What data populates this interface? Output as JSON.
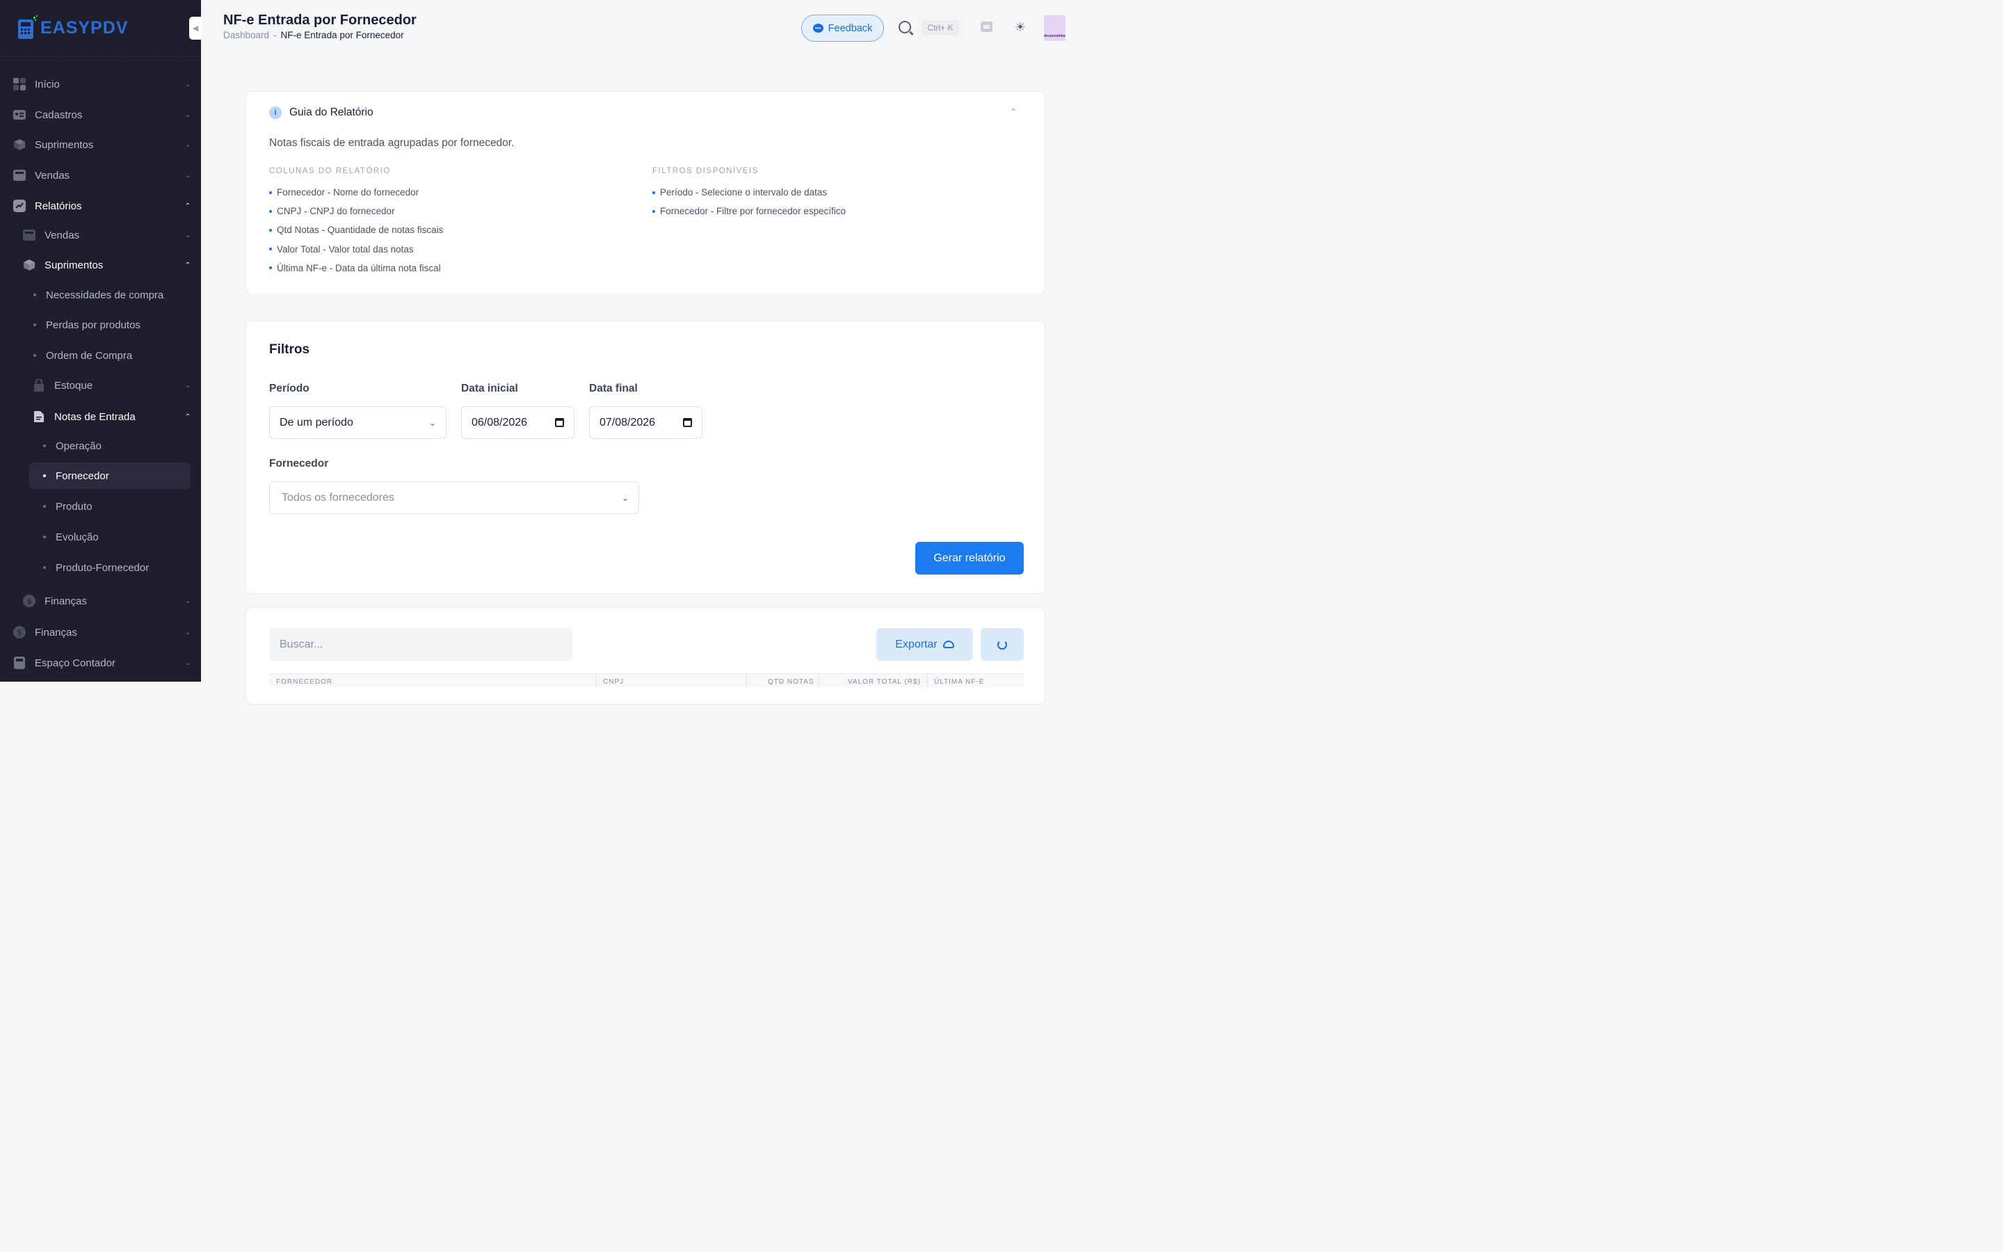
{
  "brand": {
    "name_part1": "EASY",
    "name_part2": "PDV"
  },
  "sidebar": {
    "items": [
      {
        "label": "Início"
      },
      {
        "label": "Cadastros"
      },
      {
        "label": "Suprimentos"
      },
      {
        "label": "Vendas"
      },
      {
        "label": "Relatórios"
      }
    ],
    "relatorios_children": [
      {
        "label": "Vendas"
      },
      {
        "label": "Suprimentos"
      }
    ],
    "suprimentos_children": [
      {
        "label": "Necessidades de compra"
      },
      {
        "label": "Perdas por produtos"
      },
      {
        "label": "Ordem de Compra"
      },
      {
        "label": "Estoque"
      },
      {
        "label": "Notas de Entrada"
      }
    ],
    "notas_children": [
      {
        "label": "Operação"
      },
      {
        "label": "Fornecedor"
      },
      {
        "label": "Produto"
      },
      {
        "label": "Evolução"
      },
      {
        "label": "Produto-Fornecedor"
      }
    ],
    "financas_sub": "Finanças",
    "bottom_items": [
      {
        "label": "Finanças"
      },
      {
        "label": "Espaço Contador"
      }
    ]
  },
  "header": {
    "title": "NF-e Entrada por Fornecedor",
    "breadcrumb": {
      "root": "Dashboard",
      "sep": "-",
      "current": "NF-e Entrada por Fornecedor"
    },
    "feedback_label": "Feedback",
    "shortcut": "Ctrl+ K",
    "avatar_text": "despensinha"
  },
  "guide": {
    "title": "Guia do Relatório",
    "description": "Notas fiscais de entrada agrupadas por fornecedor.",
    "columns_heading": "COLUNAS DO RELATÓRIO",
    "columns": [
      "Fornecedor - Nome do fornecedor",
      "CNPJ - CNPJ do fornecedor",
      "Qtd Notas - Quantidade de notas fiscais",
      "Valor Total - Valor total das notas",
      "Última NF-e - Data da última nota fiscal"
    ],
    "filters_heading": "FILTROS DISPONÍVEIS",
    "filters": [
      "Período - Selecione o intervalo de datas",
      "Fornecedor - Filtre por fornecedor específico"
    ]
  },
  "filters": {
    "title": "Filtros",
    "period_label": "Período",
    "period_value": "De um período",
    "start_label": "Data inicial",
    "start_value": "06/08/2026",
    "end_label": "Data final",
    "end_value": "07/08/2026",
    "supplier_label": "Fornecedor",
    "supplier_placeholder": "Todos os fornecedores",
    "generate_label": "Gerar relatório"
  },
  "results": {
    "search_placeholder": "Buscar...",
    "export_label": "Exportar",
    "columns": [
      "FORNECEDOR",
      "CNPJ",
      "QTD NOTAS",
      "VALOR TOTAL (R$)",
      "ÚLTIMA NF-E"
    ]
  },
  "colors": {
    "accent": "#1a7cf0",
    "sidebar_bg": "#1e1e2d",
    "page_bg": "#f5f6f8"
  }
}
